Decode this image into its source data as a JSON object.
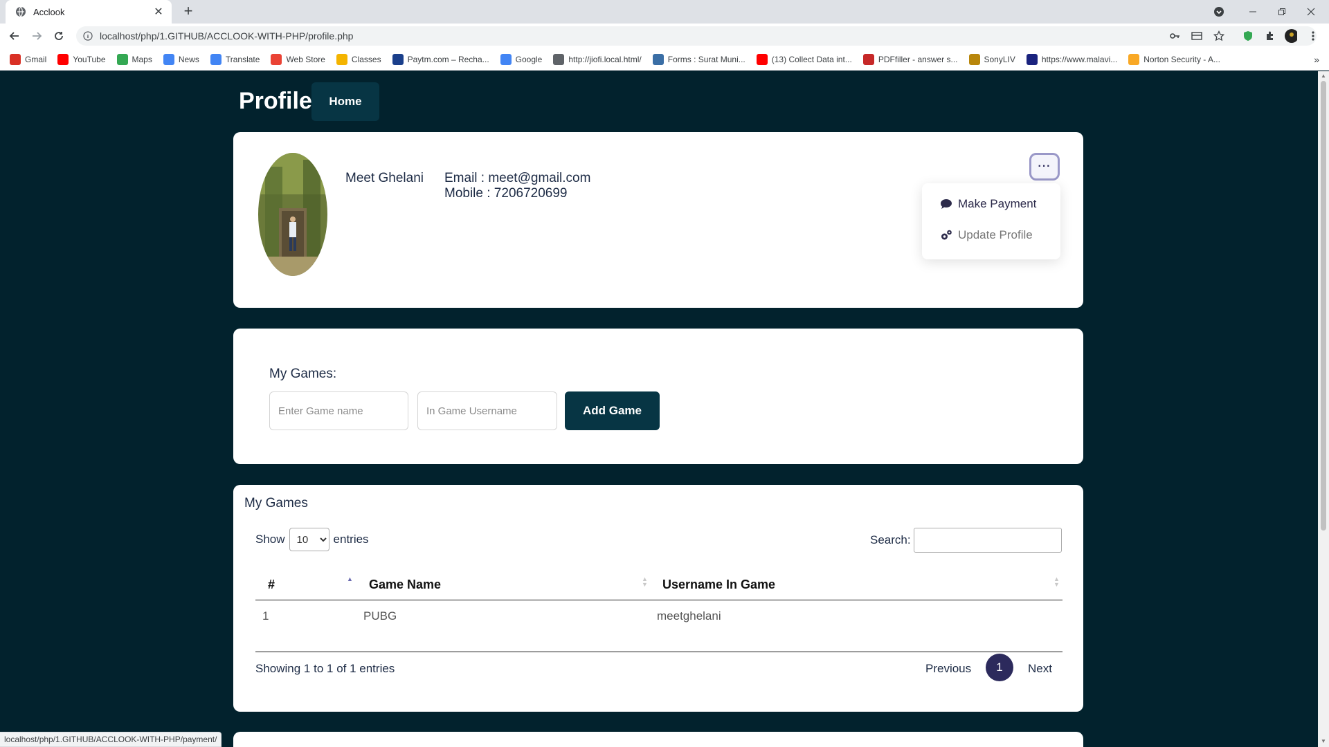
{
  "browser": {
    "tab_title": "Acclook",
    "url": "localhost/php/1.GITHUB/ACCLOOK-WITH-PHP/profile.php",
    "status_url": "localhost/php/1.GITHUB/ACCLOOK-WITH-PHP/payment/",
    "bookmarks": [
      {
        "label": "Gmail",
        "icon": "gmail-icon",
        "color": "#d93025"
      },
      {
        "label": "YouTube",
        "icon": "youtube-icon",
        "color": "#ff0000"
      },
      {
        "label": "Maps",
        "icon": "maps-icon",
        "color": "#34a853"
      },
      {
        "label": "News",
        "icon": "news-icon",
        "color": "#4285f4"
      },
      {
        "label": "Translate",
        "icon": "translate-icon",
        "color": "#4285f4"
      },
      {
        "label": "Web Store",
        "icon": "webstore-icon",
        "color": "#ea4335"
      },
      {
        "label": "Classes",
        "icon": "classes-icon",
        "color": "#f4b400"
      },
      {
        "label": "Paytm.com – Recha...",
        "icon": "paytm-icon",
        "color": "#1a3f8b"
      },
      {
        "label": "Google",
        "icon": "google-icon",
        "color": "#4285f4"
      },
      {
        "label": "http://jiofi.local.html/",
        "icon": "globe-icon",
        "color": "#5f6368"
      },
      {
        "label": "Forms : Surat Muni...",
        "icon": "forms-icon",
        "color": "#3a6ea5"
      },
      {
        "label": "(13) Collect Data int...",
        "icon": "youtube-icon",
        "color": "#ff0000"
      },
      {
        "label": "PDFfiller - answer s...",
        "icon": "pdffiller-icon",
        "color": "#c62828"
      },
      {
        "label": "SonyLIV",
        "icon": "sonyliv-icon",
        "color": "#b8860b"
      },
      {
        "label": "https://www.malavi...",
        "icon": "malavi-icon",
        "color": "#1a237e"
      },
      {
        "label": "Norton Security - A...",
        "icon": "norton-icon",
        "color": "#f9a825"
      }
    ]
  },
  "header": {
    "title": "Profile",
    "home_label": "Home"
  },
  "profile": {
    "name": "Meet Ghelani",
    "email": "Email : meet@gmail.com",
    "mobile": "Mobile : 7206720699",
    "menu_button": "···",
    "menu": {
      "make_payment": "Make Payment",
      "update_profile": "Update Profile"
    }
  },
  "add_game": {
    "label": "My Games:",
    "game_name_placeholder": "Enter Game name",
    "username_placeholder": "In Game Username",
    "button": "Add Game"
  },
  "games_table": {
    "title": "My Games",
    "show_label": "Show",
    "entries_label": "entries",
    "page_length": "10",
    "search_label": "Search:",
    "columns": [
      "#",
      "Game Name",
      "Username In Game"
    ],
    "rows": [
      [
        "1",
        "PUBG",
        "meetghelani"
      ]
    ],
    "info": "Showing 1 to 1 of 1 entries",
    "previous": "Previous",
    "current_page": "1",
    "next": "Next"
  },
  "colors": {
    "page_bg": "#02222d",
    "button_bg": "#073544",
    "page_active": "#2c2a5c"
  }
}
